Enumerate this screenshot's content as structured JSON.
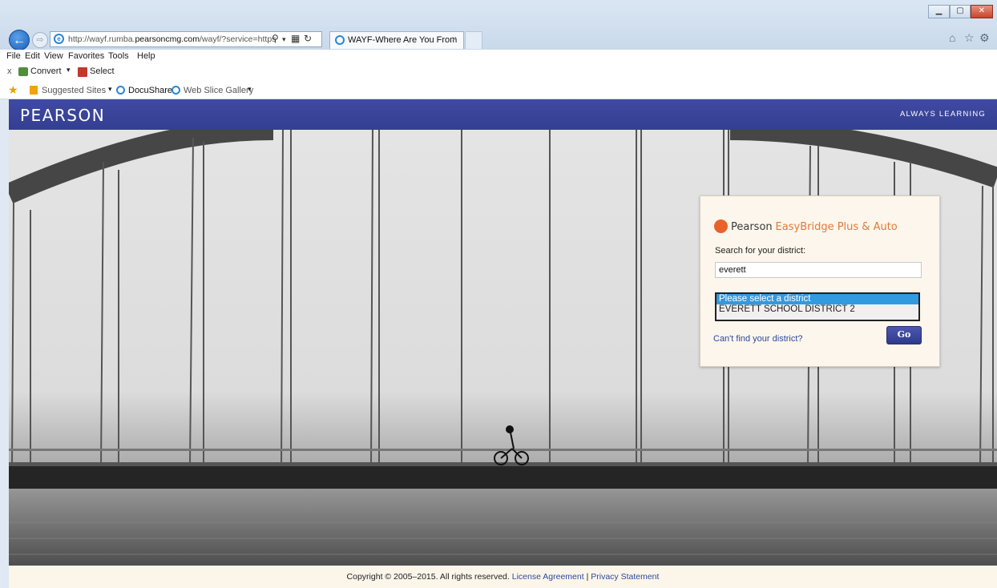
{
  "browser": {
    "url_prefix": "http://wayf.rumba.",
    "url_domain": "pearsoncmg.com",
    "url_suffix": "/wayf/?service=https",
    "tab_title": "WAYF-Where Are You From",
    "tab_close": "×"
  },
  "menu": [
    "File",
    "Edit",
    "View",
    "Favorites",
    "Tools",
    "Help"
  ],
  "command_bar": {
    "close": "x",
    "convert_label": "Convert",
    "select_label": "Select"
  },
  "favorites_bar": {
    "suggested_sites": "Suggested Sites",
    "docushare": "DocuShare",
    "web_slice_gallery": "Web Slice Gallery"
  },
  "header": {
    "brand": "PEARSON",
    "tagline": "ALWAYS LEARNING"
  },
  "login": {
    "brand_prefix": "Pearson",
    "product_name": "EasyBridge Plus & Auto",
    "search_label": "Search for your district:",
    "search_value": "everett",
    "district_options": [
      "Please select a district",
      "EVERETT SCHOOL DISTRICT 2"
    ],
    "selected_index": 0,
    "cant_find_link": "Can't find your district?",
    "go_button": "Go"
  },
  "footer": {
    "copyright": "Copyright © 2005–2015. All rights reserved.",
    "license_link": "License Agreement",
    "separator": "|",
    "privacy_link": "Privacy Statement"
  },
  "colors": {
    "header_blue": "#3a4599",
    "panel_bg": "#fdf6ec",
    "accent_orange": "#e07a3c",
    "link_blue": "#2b4a9e",
    "selected_option": "#3399e0"
  }
}
